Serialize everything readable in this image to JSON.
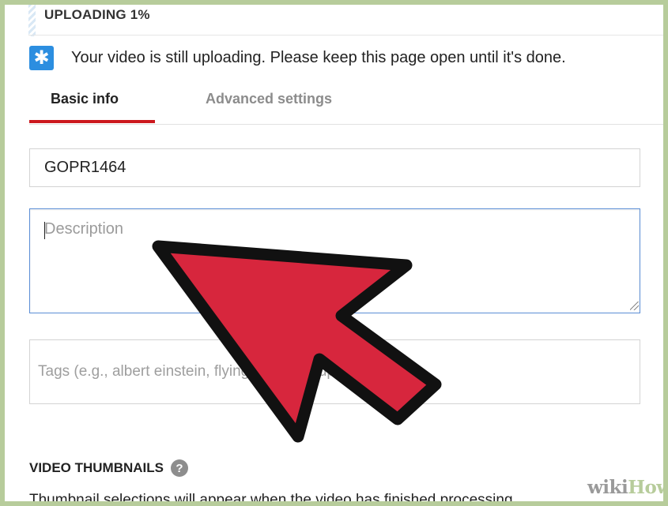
{
  "upload": {
    "status": "UPLOADING 1%",
    "notice_icon": "star-icon",
    "notice_text": "Your video is still uploading. Please keep this page open until it's done."
  },
  "tabs": [
    {
      "label": "Basic info",
      "active": true
    },
    {
      "label": "Advanced settings",
      "active": false
    }
  ],
  "form": {
    "title_value": "GOPR1464",
    "description_placeholder": "Description",
    "tags_placeholder": "Tags (e.g., albert einstein, flying pig, mashup)"
  },
  "thumbnails": {
    "heading": "VIDEO THUMBNAILS",
    "help_icon": "help-icon",
    "note": "Thumbnail selections will appear when the video has finished processing."
  },
  "overlay": {
    "arrow_color": "#d7263d",
    "arrow_outline": "#111111"
  },
  "watermark": {
    "part1": "wiki",
    "part2": "How"
  },
  "colors": {
    "accent_red": "#cc181e",
    "notice_blue": "#2c8ee0",
    "focus_blue": "#5b8ed6",
    "frame_green": "#b7cc9b"
  }
}
